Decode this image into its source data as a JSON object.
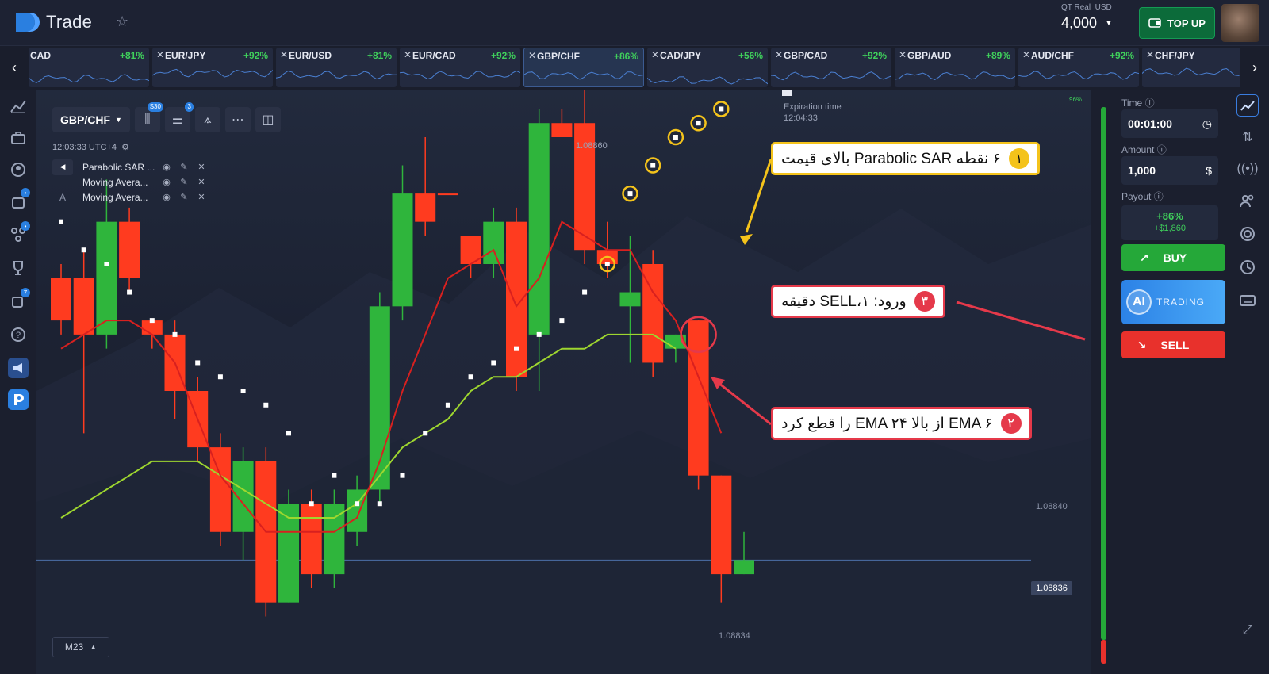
{
  "header": {
    "brand": "Trade",
    "account_label": "QT Real",
    "account_currency": "USD",
    "balance": "4,000",
    "topup_label": "TOP UP"
  },
  "pairs": [
    {
      "name": "CAD",
      "pct": "+81%"
    },
    {
      "name": "EUR/JPY",
      "pct": "+92%"
    },
    {
      "name": "EUR/USD",
      "pct": "+81%"
    },
    {
      "name": "EUR/CAD",
      "pct": "+92%"
    },
    {
      "name": "GBP/CHF",
      "pct": "+86%",
      "active": true
    },
    {
      "name": "CAD/JPY",
      "pct": "+56%"
    },
    {
      "name": "GBP/CAD",
      "pct": "+92%"
    },
    {
      "name": "GBP/AUD",
      "pct": "+89%"
    },
    {
      "name": "AUD/CHF",
      "pct": "+92%"
    },
    {
      "name": "CHF/JPY",
      "pct": "+92"
    }
  ],
  "chart_toolbar": {
    "pair": "GBP/CHF",
    "candles_badge": "S30",
    "indicators_badge": "3"
  },
  "chart_time": "12:03:33 UTC+4",
  "indicators": [
    {
      "name": "Parabolic SAR ..."
    },
    {
      "name": "Moving Avera..."
    },
    {
      "name": "Moving Avera..."
    }
  ],
  "expiration": {
    "label": "Expiration time",
    "time": "12:04:33"
  },
  "timeframe": "M23",
  "current_price": "1.08836",
  "payout_bar_pct": "96%",
  "chart_data": {
    "type": "candlestick",
    "y_ticks": [
      "1.08860",
      "1.08840",
      "1.08834"
    ],
    "ylim": [
      1.0883,
      1.08866
    ],
    "candles": [
      {
        "o": 1.08856,
        "c": 1.08853,
        "h": 1.08857,
        "l": 1.08852,
        "color": "red"
      },
      {
        "o": 1.08856,
        "c": 1.08852,
        "h": 1.08858,
        "l": 1.08845,
        "color": "red"
      },
      {
        "o": 1.08852,
        "c": 1.0886,
        "h": 1.08863,
        "l": 1.08851,
        "color": "green"
      },
      {
        "o": 1.0886,
        "c": 1.08856,
        "h": 1.08861,
        "l": 1.08855,
        "color": "red"
      },
      {
        "o": 1.08853,
        "c": 1.08852,
        "h": 1.08853,
        "l": 1.08851,
        "color": "red"
      },
      {
        "o": 1.08852,
        "c": 1.08848,
        "h": 1.08853,
        "l": 1.08846,
        "color": "red"
      },
      {
        "o": 1.08848,
        "c": 1.08844,
        "h": 1.08849,
        "l": 1.08843,
        "color": "red"
      },
      {
        "o": 1.08844,
        "c": 1.08838,
        "h": 1.08845,
        "l": 1.08837,
        "color": "red"
      },
      {
        "o": 1.08838,
        "c": 1.08843,
        "h": 1.08844,
        "l": 1.08836,
        "color": "green"
      },
      {
        "o": 1.08843,
        "c": 1.08833,
        "h": 1.08844,
        "l": 1.08832,
        "color": "red"
      },
      {
        "o": 1.08833,
        "c": 1.0884,
        "h": 1.08841,
        "l": 1.08833,
        "color": "green"
      },
      {
        "o": 1.0884,
        "c": 1.08835,
        "h": 1.08841,
        "l": 1.08834,
        "color": "red"
      },
      {
        "o": 1.08835,
        "c": 1.0884,
        "h": 1.08841,
        "l": 1.08834,
        "color": "green"
      },
      {
        "o": 1.08838,
        "c": 1.08841,
        "h": 1.08842,
        "l": 1.08837,
        "color": "green"
      },
      {
        "o": 1.08841,
        "c": 1.08854,
        "h": 1.08855,
        "l": 1.0884,
        "color": "green"
      },
      {
        "o": 1.08854,
        "c": 1.08862,
        "h": 1.08864,
        "l": 1.08853,
        "color": "green"
      },
      {
        "o": 1.08862,
        "c": 1.0886,
        "h": 1.08866,
        "l": 1.08859,
        "color": "red"
      },
      {
        "o": 1.08862,
        "c": 1.08862,
        "h": 1.08862,
        "l": 1.08862,
        "color": "red"
      },
      {
        "o": 1.08859,
        "c": 1.08857,
        "h": 1.08859,
        "l": 1.08856,
        "color": "red"
      },
      {
        "o": 1.08857,
        "c": 1.0886,
        "h": 1.08861,
        "l": 1.08856,
        "color": "green"
      },
      {
        "o": 1.0886,
        "c": 1.08849,
        "h": 1.08861,
        "l": 1.08848,
        "color": "red"
      },
      {
        "o": 1.08852,
        "c": 1.08867,
        "h": 1.08868,
        "l": 1.08848,
        "color": "green"
      },
      {
        "o": 1.08867,
        "c": 1.08866,
        "h": 1.08868,
        "l": 1.08866,
        "color": "red"
      },
      {
        "o": 1.08867,
        "c": 1.08858,
        "h": 1.0887,
        "l": 1.08857,
        "color": "red"
      },
      {
        "o": 1.08858,
        "c": 1.08857,
        "h": 1.0886,
        "l": 1.08856,
        "color": "red"
      },
      {
        "o": 1.08855,
        "c": 1.08854,
        "h": 1.08859,
        "l": 1.0885,
        "color": "green"
      },
      {
        "o": 1.08857,
        "c": 1.0885,
        "h": 1.08858,
        "l": 1.08849,
        "color": "red"
      },
      {
        "o": 1.08851,
        "c": 1.08852,
        "h": 1.08852,
        "l": 1.0885,
        "color": "green"
      },
      {
        "o": 1.08853,
        "c": 1.08842,
        "h": 1.08853,
        "l": 1.08841,
        "color": "red"
      },
      {
        "o": 1.08842,
        "c": 1.08835,
        "h": 1.08842,
        "l": 1.08833,
        "color": "red"
      },
      {
        "o": 1.08835,
        "c": 1.08836,
        "h": 1.08838,
        "l": 1.08835,
        "color": "green"
      }
    ],
    "ema_fast": [
      1.08851,
      1.08852,
      1.08853,
      1.08853,
      1.08852,
      1.0885,
      1.08846,
      1.08842,
      1.0884,
      1.08838,
      1.08838,
      1.08838,
      1.08838,
      1.08839,
      1.08843,
      1.08848,
      1.08852,
      1.08856,
      1.08857,
      1.08858,
      1.08854,
      1.08856,
      1.0886,
      1.08859,
      1.08858,
      1.08858,
      1.08855,
      1.08853,
      1.08849,
      1.08845
    ],
    "ema_slow": [
      1.08839,
      1.0884,
      1.08841,
      1.08842,
      1.08843,
      1.08843,
      1.08843,
      1.08842,
      1.08841,
      1.0884,
      1.08839,
      1.08839,
      1.08839,
      1.0884,
      1.08842,
      1.08844,
      1.08845,
      1.08846,
      1.08848,
      1.08849,
      1.08849,
      1.0885,
      1.08851,
      1.08851,
      1.08852,
      1.08852,
      1.08852,
      1.08851
    ],
    "sar": [
      1.0886,
      1.08858,
      1.08857,
      1.08855,
      1.08853,
      1.08852,
      1.0885,
      1.08849,
      1.08848,
      1.08847,
      1.08845,
      1.0884,
      1.08842,
      1.0884,
      1.0884,
      1.08842,
      1.08845,
      1.08847,
      1.08849,
      1.0885,
      1.08851,
      1.08852,
      1.08853,
      1.08855,
      1.08857,
      1.08862,
      1.08864,
      1.08866,
      1.08867,
      1.08868
    ]
  },
  "annotations": {
    "a1_num": "۱",
    "a1_text": "۶ نقطه Parabolic SAR بالای قیمت",
    "a2_num": "۲",
    "a2_text": "EMA ۶ از بالا EMA ۲۴ را قطع کرد",
    "a3_num": "۳",
    "a3_text": "ورود: SELL،۱ دقیقه"
  },
  "panel": {
    "time_label": "Time",
    "time_value": "00:01:00",
    "amount_label": "Amount",
    "amount_value": "1,000",
    "payout_label": "Payout",
    "payout_pct": "+86%",
    "payout_amount": "+$1,860",
    "buy_label": "BUY",
    "ai_label": "AI",
    "ai_sub": "TRADING",
    "sell_label": "SELL"
  },
  "colors": {
    "buy": "#25a839",
    "sell": "#e8312c",
    "candle_up": "#2fb53c",
    "candle_down": "#ff3b1f",
    "ema_fast": "#d8201f",
    "ema_slow": "#9ed62f",
    "annotation_yellow": "#f4c31b",
    "annotation_red": "#e5394a"
  }
}
